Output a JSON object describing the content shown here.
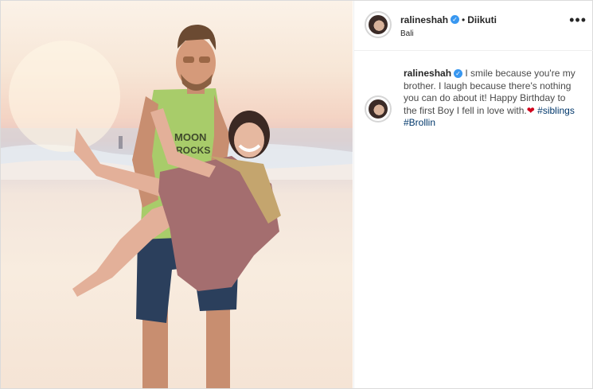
{
  "post": {
    "username": "ralineshah",
    "verified_mark": "✓",
    "separator": "•",
    "follow_status": "Diikuti",
    "location": "Bali",
    "more_icon": "•••",
    "caption": {
      "text": "I smile because you're my brother. I laugh because there's nothing you can do about it! Happy Birthday to the first Boy I fell in love with.",
      "heart": "❤",
      "hashtags": [
        "#siblings",
        "#Brollin"
      ]
    }
  },
  "colors": {
    "verified": "#3897f0",
    "hashtag": "#00376b",
    "heart": "#d0021b"
  }
}
